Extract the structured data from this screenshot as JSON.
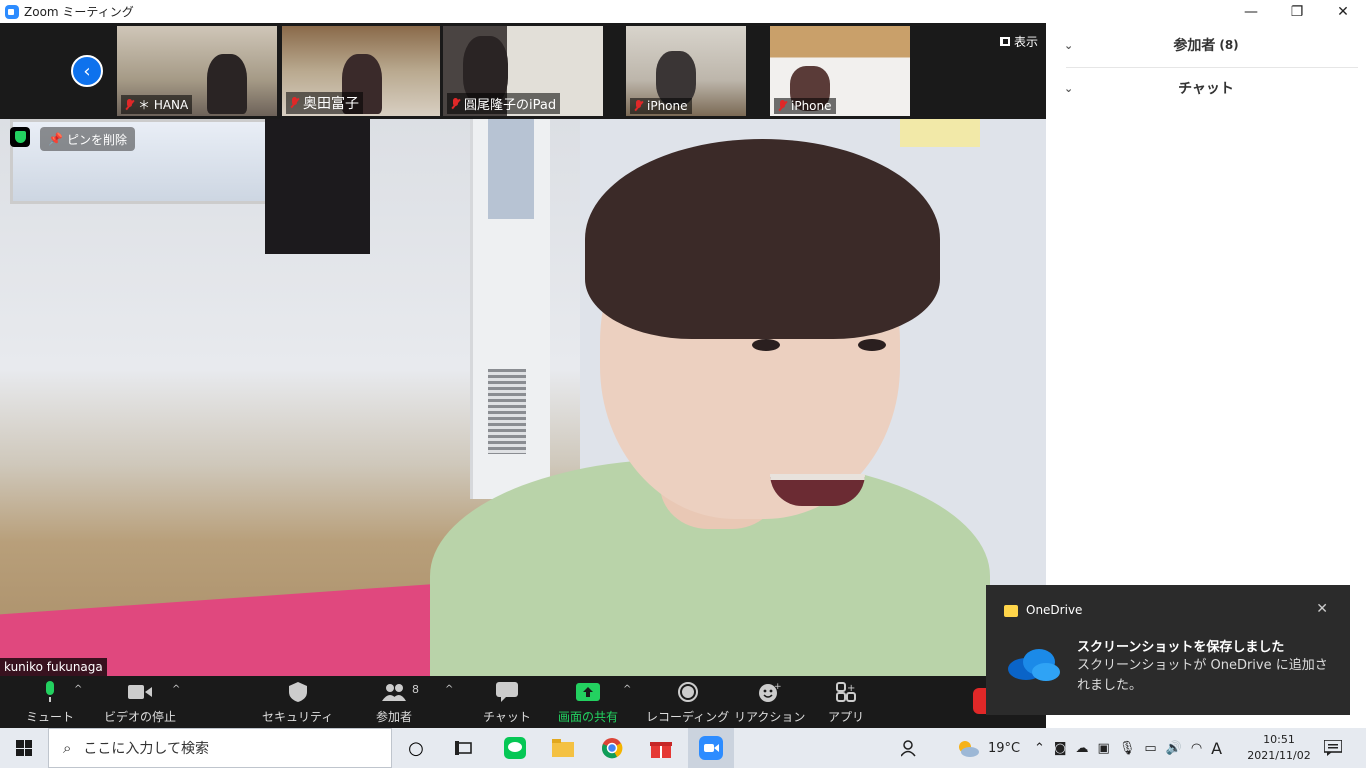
{
  "window": {
    "title": "Zoom ミーティング"
  },
  "thumbnails": [
    {
      "name": "＊ HANA"
    },
    {
      "name": "奥田富子"
    },
    {
      "name": "圓尾隆子のiPad"
    },
    {
      "name": "iPhone"
    },
    {
      "name": "iPhone"
    }
  ],
  "view_button": "表示",
  "main_video": {
    "speaker": "kuniko fukunaga",
    "unpin": "ピンを削除"
  },
  "toolbar": {
    "mute": "ミュート",
    "stop_video": "ビデオの停止",
    "security": "セキュリティ",
    "participants": "参加者",
    "participants_count": "8",
    "chat": "チャット",
    "share": "画面の共有",
    "record": "レコーディング",
    "reactions": "リアクション",
    "apps": "アプリ"
  },
  "side_panel": {
    "participants_header": "参加者",
    "participants_count": "(8)",
    "chat_header": "チャット"
  },
  "toast": {
    "app": "OneDrive",
    "title": "スクリーンショットを保存しました",
    "body": "スクリーンショットが OneDrive に追加されました。"
  },
  "taskbar": {
    "search_placeholder": "ここに入力して検索",
    "weather": "19°C",
    "ime": "A",
    "time": "10:51",
    "date": "2021/11/02"
  },
  "colors": {
    "zoom_blue": "#0e72ed",
    "share_green": "#23d160",
    "muted_red": "#e02828"
  }
}
